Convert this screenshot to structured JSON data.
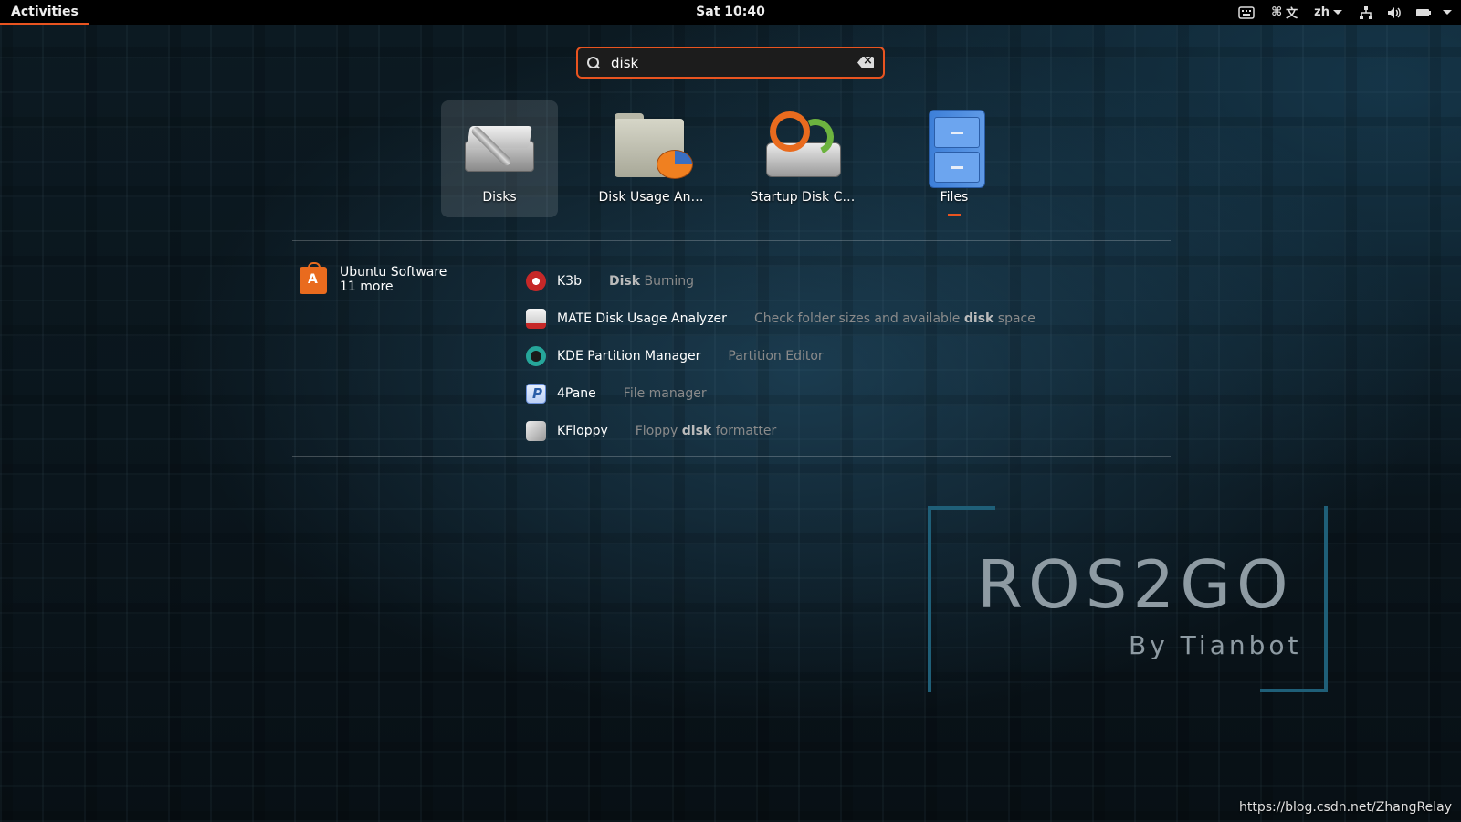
{
  "topbar": {
    "activities": "Activities",
    "clock": "Sat 10:40",
    "tray": {
      "keyboard_icon": "keyboard-icon",
      "input_method": "⌘",
      "language": "zh",
      "network_icon": "network-icon",
      "volume_icon": "volume-icon",
      "battery_icon": "battery-icon"
    }
  },
  "search": {
    "value": "disk",
    "placeholder": ""
  },
  "apps": [
    {
      "label": "Disks",
      "icon": "disks-icon",
      "selected": true
    },
    {
      "label": "Disk Usage An…",
      "icon": "disk-usage-analyzer-icon"
    },
    {
      "label": "Startup Disk C…",
      "icon": "startup-disk-creator-icon"
    },
    {
      "label": "Files",
      "icon": "files-icon",
      "running": true
    }
  ],
  "provider": {
    "name": "Ubuntu Software",
    "more": "11 more",
    "icon": "ubuntu-software-icon"
  },
  "results": [
    {
      "name": "K3b",
      "desc_bold": "Disk",
      "desc_rest": " Burning",
      "icon": "k3b-icon"
    },
    {
      "name": "MATE Disk Usage Analyzer",
      "desc_pre": "Check folder sizes and available ",
      "desc_bold": "disk",
      "desc_rest": " space",
      "icon": "mate-disk-usage-icon"
    },
    {
      "name": "KDE Partition Manager",
      "desc_rest": "Partition Editor",
      "icon": "kde-partition-manager-icon"
    },
    {
      "name": "4Pane",
      "desc_rest": "File manager",
      "icon": "4pane-icon"
    },
    {
      "name": "KFloppy",
      "desc_pre": "Floppy ",
      "desc_bold": "disk",
      "desc_rest": " formatter",
      "icon": "kfloppy-icon"
    }
  ],
  "watermark": {
    "title": "ROS2GO",
    "subtitle": "By Tianbot",
    "url": "https://blog.csdn.net/ZhangRelay"
  },
  "colors": {
    "accent": "#e95420",
    "topbar": "#000000"
  }
}
